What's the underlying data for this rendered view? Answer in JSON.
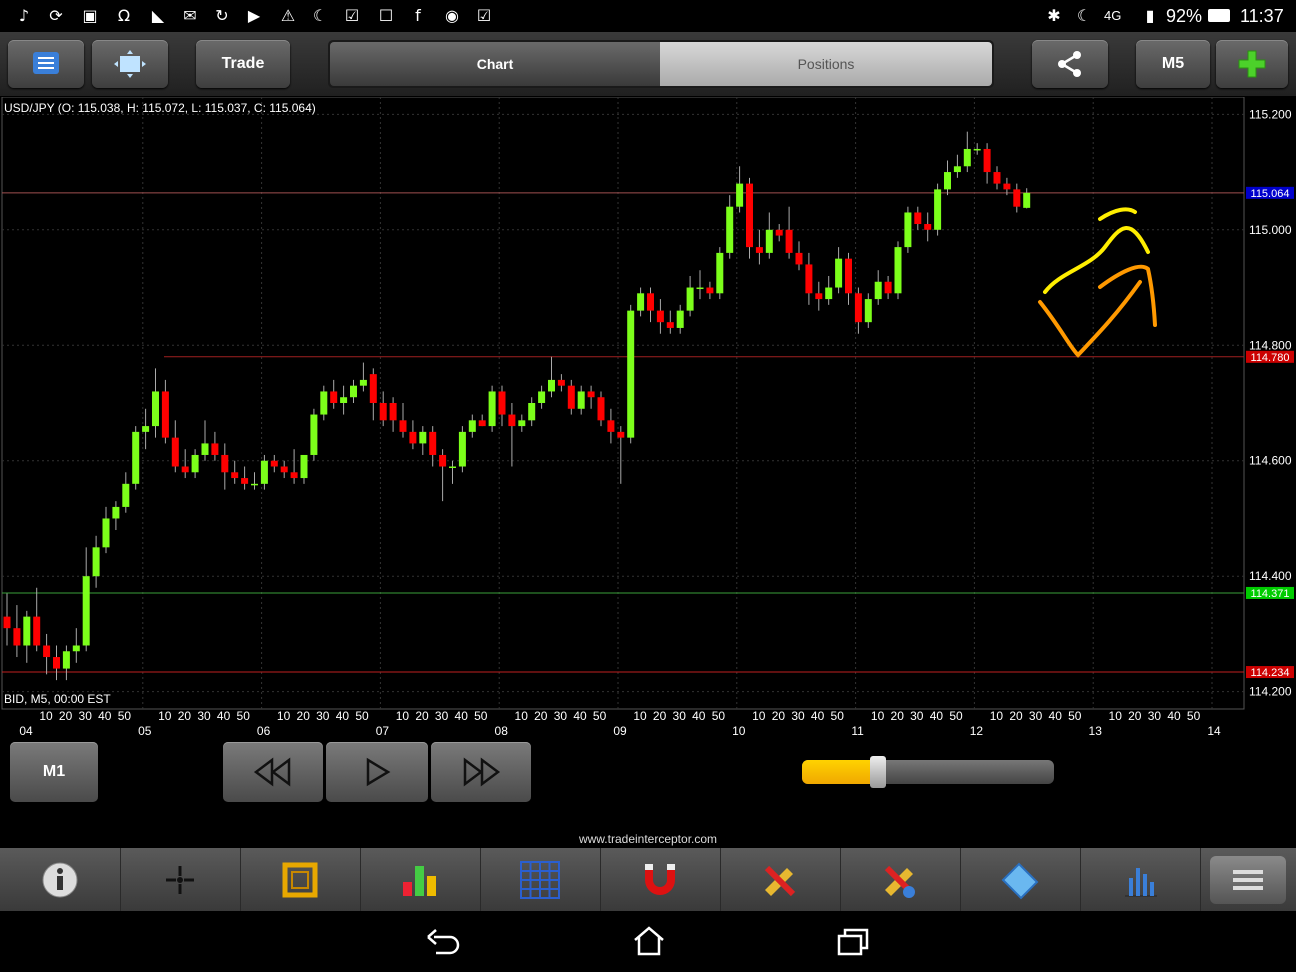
{
  "status_bar": {
    "battery": "92%",
    "time": "11:37",
    "network": "4G"
  },
  "toolbar": {
    "trade_label": "Trade",
    "tab_chart": "Chart",
    "tab_positions": "Positions",
    "timeframe_label": "M5"
  },
  "chart": {
    "header": "USD/JPY (O: 115.038, H: 115.072, L: 115.037, C: 115.064)",
    "footer": "BID, M5, 00:00 EST",
    "price_ticks": [
      "115.200",
      "115.000",
      "114.800",
      "114.600",
      "114.400",
      "114.200"
    ],
    "line_labels": {
      "current": "115.064",
      "resistance": "114.780",
      "support_green": "114.371",
      "support_red": "114.234"
    },
    "colors": {
      "bull": "#7cff1a",
      "bear": "#ff0000",
      "current_line": "#0000cc",
      "resistance_line": "#cc0000",
      "support_line": "#00cc00",
      "annotation_yellow": "#ffee00",
      "annotation_orange": "#ff9900"
    }
  },
  "chart_data": {
    "type": "candlestick",
    "title": "USD/JPY (O: 115.038, H: 115.072, L: 115.037, C: 115.064)",
    "ylim": [
      114.17,
      115.23
    ],
    "hours": [
      "04",
      "05",
      "06",
      "07",
      "08",
      "09",
      "10",
      "11",
      "12",
      "13",
      "14"
    ],
    "minute_ticks": [
      "10",
      "20",
      "30",
      "40",
      "50"
    ],
    "candles": [
      {
        "o": 114.33,
        "h": 114.37,
        "l": 114.28,
        "c": 114.31
      },
      {
        "o": 114.31,
        "h": 114.35,
        "l": 114.26,
        "c": 114.28
      },
      {
        "o": 114.28,
        "h": 114.34,
        "l": 114.25,
        "c": 114.33
      },
      {
        "o": 114.33,
        "h": 114.38,
        "l": 114.27,
        "c": 114.28
      },
      {
        "o": 114.28,
        "h": 114.3,
        "l": 114.23,
        "c": 114.26
      },
      {
        "o": 114.26,
        "h": 114.28,
        "l": 114.22,
        "c": 114.24
      },
      {
        "o": 114.24,
        "h": 114.28,
        "l": 114.22,
        "c": 114.27
      },
      {
        "o": 114.27,
        "h": 114.31,
        "l": 114.25,
        "c": 114.28
      },
      {
        "o": 114.28,
        "h": 114.45,
        "l": 114.27,
        "c": 114.4
      },
      {
        "o": 114.4,
        "h": 114.47,
        "l": 114.38,
        "c": 114.45
      },
      {
        "o": 114.45,
        "h": 114.52,
        "l": 114.44,
        "c": 114.5
      },
      {
        "o": 114.5,
        "h": 114.53,
        "l": 114.48,
        "c": 114.52
      },
      {
        "o": 114.52,
        "h": 114.58,
        "l": 114.51,
        "c": 114.56
      },
      {
        "o": 114.56,
        "h": 114.66,
        "l": 114.55,
        "c": 114.65
      },
      {
        "o": 114.65,
        "h": 114.69,
        "l": 114.62,
        "c": 114.66
      },
      {
        "o": 114.66,
        "h": 114.76,
        "l": 114.64,
        "c": 114.72
      },
      {
        "o": 114.72,
        "h": 114.74,
        "l": 114.63,
        "c": 114.64
      },
      {
        "o": 114.64,
        "h": 114.67,
        "l": 114.58,
        "c": 114.59
      },
      {
        "o": 114.59,
        "h": 114.62,
        "l": 114.57,
        "c": 114.58
      },
      {
        "o": 114.58,
        "h": 114.62,
        "l": 114.57,
        "c": 114.61
      },
      {
        "o": 114.61,
        "h": 114.67,
        "l": 114.6,
        "c": 114.63
      },
      {
        "o": 114.63,
        "h": 114.65,
        "l": 114.6,
        "c": 114.61
      },
      {
        "o": 114.61,
        "h": 114.63,
        "l": 114.55,
        "c": 114.58
      },
      {
        "o": 114.58,
        "h": 114.6,
        "l": 114.56,
        "c": 114.57
      },
      {
        "o": 114.57,
        "h": 114.59,
        "l": 114.55,
        "c": 114.56
      },
      {
        "o": 114.56,
        "h": 114.58,
        "l": 114.55,
        "c": 114.56
      },
      {
        "o": 114.56,
        "h": 114.61,
        "l": 114.55,
        "c": 114.6
      },
      {
        "o": 114.6,
        "h": 114.61,
        "l": 114.58,
        "c": 114.59
      },
      {
        "o": 114.59,
        "h": 114.6,
        "l": 114.57,
        "c": 114.58
      },
      {
        "o": 114.58,
        "h": 114.62,
        "l": 114.56,
        "c": 114.57
      },
      {
        "o": 114.57,
        "h": 114.61,
        "l": 114.56,
        "c": 114.61
      },
      {
        "o": 114.61,
        "h": 114.69,
        "l": 114.6,
        "c": 114.68
      },
      {
        "o": 114.68,
        "h": 114.73,
        "l": 114.67,
        "c": 114.72
      },
      {
        "o": 114.72,
        "h": 114.74,
        "l": 114.69,
        "c": 114.7
      },
      {
        "o": 114.7,
        "h": 114.73,
        "l": 114.68,
        "c": 114.71
      },
      {
        "o": 114.71,
        "h": 114.74,
        "l": 114.7,
        "c": 114.73
      },
      {
        "o": 114.73,
        "h": 114.77,
        "l": 114.72,
        "c": 114.74
      },
      {
        "o": 114.75,
        "h": 114.76,
        "l": 114.67,
        "c": 114.7
      },
      {
        "o": 114.7,
        "h": 114.72,
        "l": 114.66,
        "c": 114.67
      },
      {
        "o": 114.7,
        "h": 114.71,
        "l": 114.65,
        "c": 114.67
      },
      {
        "o": 114.67,
        "h": 114.7,
        "l": 114.64,
        "c": 114.65
      },
      {
        "o": 114.65,
        "h": 114.67,
        "l": 114.62,
        "c": 114.63
      },
      {
        "o": 114.63,
        "h": 114.66,
        "l": 114.61,
        "c": 114.65
      },
      {
        "o": 114.65,
        "h": 114.66,
        "l": 114.59,
        "c": 114.61
      },
      {
        "o": 114.61,
        "h": 114.62,
        "l": 114.53,
        "c": 114.59
      },
      {
        "o": 114.59,
        "h": 114.6,
        "l": 114.56,
        "c": 114.59
      },
      {
        "o": 114.59,
        "h": 114.66,
        "l": 114.58,
        "c": 114.65
      },
      {
        "o": 114.65,
        "h": 114.68,
        "l": 114.64,
        "c": 114.67
      },
      {
        "o": 114.67,
        "h": 114.68,
        "l": 114.66,
        "c": 114.66
      },
      {
        "o": 114.66,
        "h": 114.73,
        "l": 114.65,
        "c": 114.72
      },
      {
        "o": 114.72,
        "h": 114.73,
        "l": 114.66,
        "c": 114.68
      },
      {
        "o": 114.68,
        "h": 114.7,
        "l": 114.59,
        "c": 114.66
      },
      {
        "o": 114.66,
        "h": 114.68,
        "l": 114.65,
        "c": 114.67
      },
      {
        "o": 114.67,
        "h": 114.71,
        "l": 114.66,
        "c": 114.7
      },
      {
        "o": 114.7,
        "h": 114.73,
        "l": 114.69,
        "c": 114.72
      },
      {
        "o": 114.72,
        "h": 114.78,
        "l": 114.71,
        "c": 114.74
      },
      {
        "o": 114.74,
        "h": 114.75,
        "l": 114.72,
        "c": 114.73
      },
      {
        "o": 114.73,
        "h": 114.74,
        "l": 114.68,
        "c": 114.69
      },
      {
        "o": 114.69,
        "h": 114.73,
        "l": 114.68,
        "c": 114.72
      },
      {
        "o": 114.72,
        "h": 114.73,
        "l": 114.69,
        "c": 114.71
      },
      {
        "o": 114.71,
        "h": 114.72,
        "l": 114.66,
        "c": 114.67
      },
      {
        "o": 114.67,
        "h": 114.69,
        "l": 114.63,
        "c": 114.65
      },
      {
        "o": 114.65,
        "h": 114.66,
        "l": 114.56,
        "c": 114.64
      },
      {
        "o": 114.64,
        "h": 114.87,
        "l": 114.63,
        "c": 114.86
      },
      {
        "o": 114.86,
        "h": 114.9,
        "l": 114.85,
        "c": 114.89
      },
      {
        "o": 114.89,
        "h": 114.9,
        "l": 114.84,
        "c": 114.86
      },
      {
        "o": 114.86,
        "h": 114.88,
        "l": 114.82,
        "c": 114.84
      },
      {
        "o": 114.84,
        "h": 114.86,
        "l": 114.82,
        "c": 114.83
      },
      {
        "o": 114.83,
        "h": 114.87,
        "l": 114.82,
        "c": 114.86
      },
      {
        "o": 114.86,
        "h": 114.92,
        "l": 114.85,
        "c": 114.9
      },
      {
        "o": 114.9,
        "h": 114.93,
        "l": 114.88,
        "c": 114.9
      },
      {
        "o": 114.9,
        "h": 114.91,
        "l": 114.88,
        "c": 114.89
      },
      {
        "o": 114.89,
        "h": 114.97,
        "l": 114.88,
        "c": 114.96
      },
      {
        "o": 114.96,
        "h": 115.06,
        "l": 114.95,
        "c": 115.04
      },
      {
        "o": 115.04,
        "h": 115.11,
        "l": 115.03,
        "c": 115.08
      },
      {
        "o": 115.08,
        "h": 115.09,
        "l": 114.95,
        "c": 114.97
      },
      {
        "o": 114.97,
        "h": 115.0,
        "l": 114.94,
        "c": 114.96
      },
      {
        "o": 114.96,
        "h": 115.03,
        "l": 114.95,
        "c": 115.0
      },
      {
        "o": 115.0,
        "h": 115.01,
        "l": 114.98,
        "c": 114.99
      },
      {
        "o": 115.0,
        "h": 115.04,
        "l": 114.95,
        "c": 114.96
      },
      {
        "o": 114.96,
        "h": 114.98,
        "l": 114.93,
        "c": 114.94
      },
      {
        "o": 114.94,
        "h": 114.96,
        "l": 114.87,
        "c": 114.89
      },
      {
        "o": 114.89,
        "h": 114.91,
        "l": 114.86,
        "c": 114.88
      },
      {
        "o": 114.88,
        "h": 114.92,
        "l": 114.87,
        "c": 114.9
      },
      {
        "o": 114.9,
        "h": 114.97,
        "l": 114.89,
        "c": 114.95
      },
      {
        "o": 114.95,
        "h": 114.96,
        "l": 114.87,
        "c": 114.89
      },
      {
        "o": 114.89,
        "h": 114.9,
        "l": 114.82,
        "c": 114.84
      },
      {
        "o": 114.84,
        "h": 114.89,
        "l": 114.83,
        "c": 114.88
      },
      {
        "o": 114.88,
        "h": 114.93,
        "l": 114.87,
        "c": 114.91
      },
      {
        "o": 114.91,
        "h": 114.92,
        "l": 114.88,
        "c": 114.89
      },
      {
        "o": 114.89,
        "h": 114.98,
        "l": 114.88,
        "c": 114.97
      },
      {
        "o": 114.97,
        "h": 115.04,
        "l": 114.96,
        "c": 115.03
      },
      {
        "o": 115.03,
        "h": 115.04,
        "l": 115.0,
        "c": 115.01
      },
      {
        "o": 115.01,
        "h": 115.03,
        "l": 114.98,
        "c": 115.0
      },
      {
        "o": 115.0,
        "h": 115.08,
        "l": 114.99,
        "c": 115.07
      },
      {
        "o": 115.07,
        "h": 115.12,
        "l": 115.06,
        "c": 115.1
      },
      {
        "o": 115.1,
        "h": 115.13,
        "l": 115.09,
        "c": 115.11
      },
      {
        "o": 115.11,
        "h": 115.17,
        "l": 115.1,
        "c": 115.14
      },
      {
        "o": 115.14,
        "h": 115.15,
        "l": 115.13,
        "c": 115.14
      },
      {
        "o": 115.14,
        "h": 115.15,
        "l": 115.08,
        "c": 115.1
      },
      {
        "o": 115.1,
        "h": 115.11,
        "l": 115.07,
        "c": 115.08
      },
      {
        "o": 115.08,
        "h": 115.09,
        "l": 115.06,
        "c": 115.07
      },
      {
        "o": 115.07,
        "h": 115.08,
        "l": 115.03,
        "c": 115.04
      },
      {
        "o": 115.038,
        "h": 115.072,
        "l": 115.037,
        "c": 115.064
      }
    ],
    "horizontal_lines": [
      {
        "label": "115.064",
        "value": 115.064
      },
      {
        "label": "114.780",
        "value": 114.78
      },
      {
        "label": "114.371",
        "value": 114.371
      },
      {
        "label": "114.234",
        "value": 114.234
      }
    ]
  },
  "controls": {
    "m1_label": "M1",
    "slider_fraction": 0.3
  },
  "footer": {
    "website": "www.tradeinterceptor.com"
  }
}
